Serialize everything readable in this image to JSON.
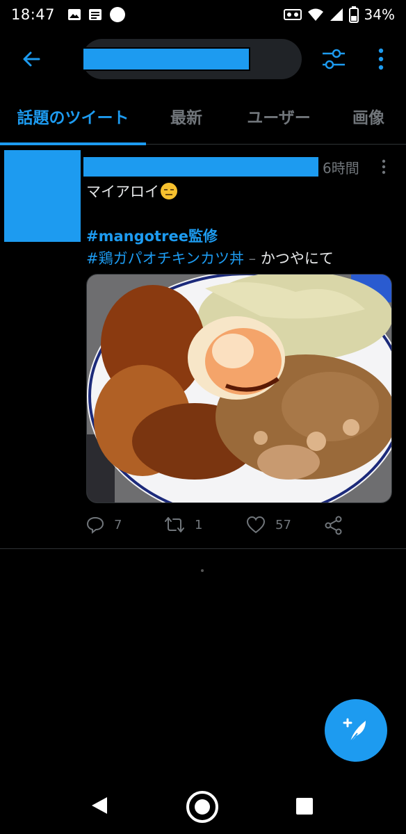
{
  "status_bar": {
    "time": "18:47",
    "battery_percent": "34%",
    "icons": [
      "image-icon",
      "message-icon",
      "circle-icon",
      "voicemail-icon",
      "wifi-icon",
      "signal-icon",
      "battery-icon"
    ]
  },
  "topbar": {
    "back_icon": "arrow-left-icon",
    "search_value_redacted": true,
    "filter_icon": "sliders-icon",
    "more_icon": "more-vertical-icon"
  },
  "tabs": [
    {
      "label": "話題のツイート",
      "active": true
    },
    {
      "label": "最新",
      "active": false
    },
    {
      "label": "ユーザー",
      "active": false
    },
    {
      "label": "画像",
      "active": false
    }
  ],
  "tweet": {
    "time": "6時間",
    "text_line1": "マイアロイ",
    "emoji": "expressionless-face",
    "hashtag1": "#mangotree監修",
    "hashtag2": "#鶏ガパオチキンカツ丼",
    "separator": " – ",
    "place": "かつやにて",
    "reply_count": "7",
    "retweet_count": "1",
    "like_count": "57"
  },
  "colors": {
    "accent": "#1d9bf0",
    "background": "#000000",
    "muted": "#71767b",
    "text": "#e7e9ea"
  }
}
